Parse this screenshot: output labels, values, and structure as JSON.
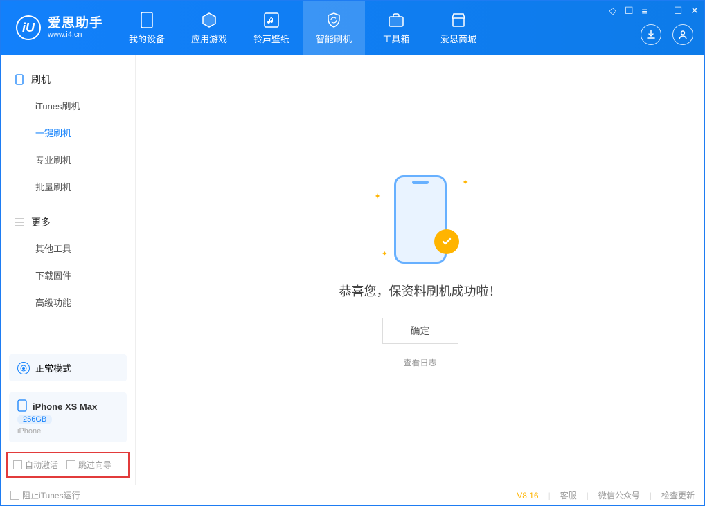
{
  "app": {
    "title": "爱思助手",
    "subtitle": "www.i4.cn",
    "logo_letter": "iU"
  },
  "tabs": [
    {
      "label": "我的设备"
    },
    {
      "label": "应用游戏"
    },
    {
      "label": "铃声壁纸"
    },
    {
      "label": "智能刷机"
    },
    {
      "label": "工具箱"
    },
    {
      "label": "爱思商城"
    }
  ],
  "sidebar": {
    "group1": {
      "title": "刷机",
      "items": [
        "iTunes刷机",
        "一键刷机",
        "专业刷机",
        "批量刷机"
      ]
    },
    "group2": {
      "title": "更多",
      "items": [
        "其他工具",
        "下载固件",
        "高级功能"
      ]
    }
  },
  "mode": {
    "label": "正常模式"
  },
  "device": {
    "name": "iPhone XS Max",
    "storage": "256GB",
    "type": "iPhone"
  },
  "options": {
    "opt1": "自动激活",
    "opt2": "跳过向导"
  },
  "main": {
    "success_text": "恭喜您，保资料刷机成功啦！",
    "ok_button": "确定",
    "log_link": "查看日志"
  },
  "footer": {
    "block_itunes": "阻止iTunes运行",
    "version": "V8.16",
    "kefu": "客服",
    "wechat": "微信公众号",
    "update": "检查更新"
  }
}
